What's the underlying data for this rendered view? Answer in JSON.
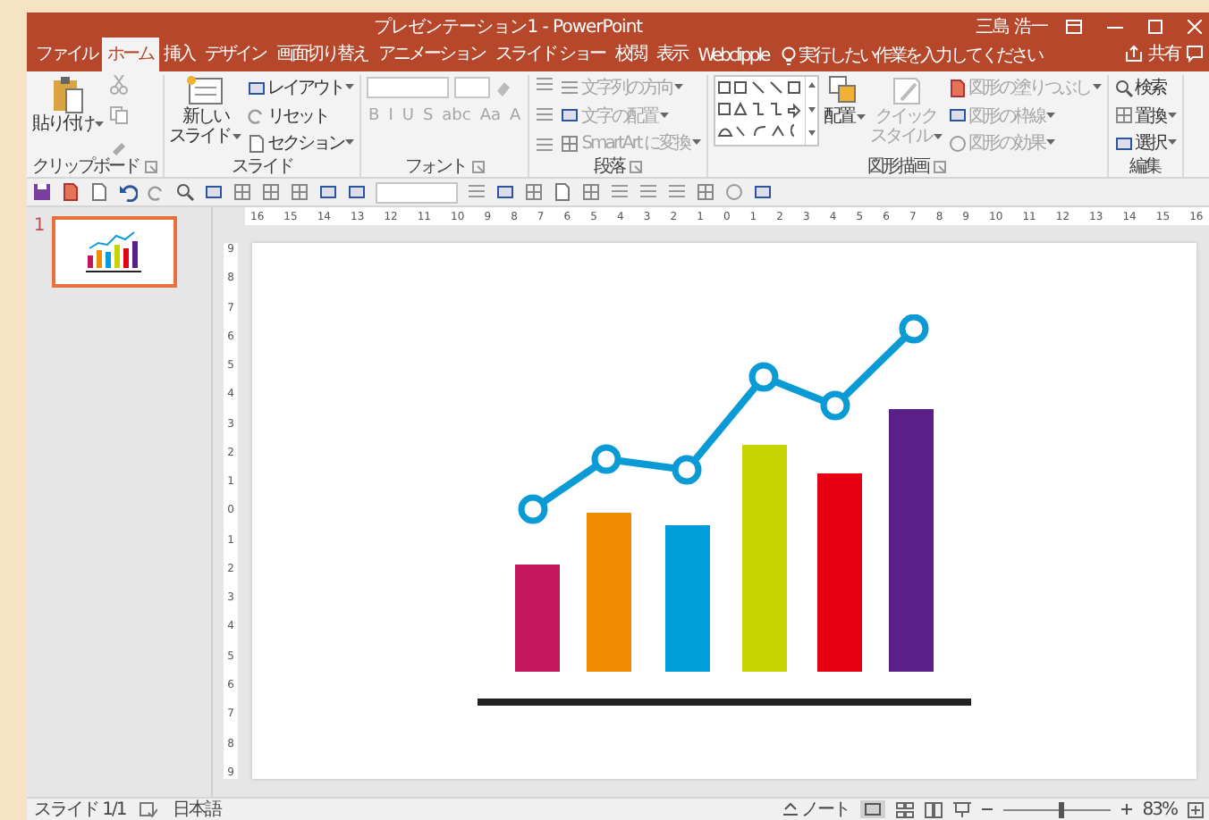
{
  "window": {
    "title": "プレゼンテーション1 - PowerPoint",
    "user": "三島 浩一"
  },
  "tabs": [
    {
      "label": "ファイル",
      "selected": false
    },
    {
      "label": "ホーム",
      "selected": true
    },
    {
      "label": "挿入",
      "selected": false
    },
    {
      "label": "デザイン",
      "selected": false
    },
    {
      "label": "画面切り替え",
      "selected": false
    },
    {
      "label": "アニメーション",
      "selected": false
    },
    {
      "label": "スライド ショー",
      "selected": false
    },
    {
      "label": "校閲",
      "selected": false
    },
    {
      "label": "表示",
      "selected": false
    },
    {
      "label": "Webclipple",
      "selected": false
    }
  ],
  "tell_me": {
    "placeholder": "実行したい作業を入力してください"
  },
  "share": "共有",
  "ribbon": {
    "groups": [
      {
        "kind": "clipboard",
        "label": "クリップボード",
        "disabled": false,
        "paste": "貼り付け"
      },
      {
        "kind": "slides",
        "label": "スライド",
        "disabled": false,
        "new_slide": [
          "新しい",
          "スライド"
        ],
        "commands": [
          "レイアウト",
          "リセット",
          "セクション"
        ]
      },
      {
        "kind": "font",
        "label": "フォント",
        "disabled": true,
        "styles": [
          "B",
          "I",
          "U",
          "S",
          "abc",
          "Aa",
          "A"
        ]
      },
      {
        "kind": "paragraph",
        "label": "段落",
        "disabled": true,
        "commands": [
          "文字列の方向",
          "文字の配置",
          "SmartArt に変換"
        ]
      },
      {
        "kind": "drawing",
        "label": "図形描画",
        "disabled": true,
        "arrange": "配置",
        "quick_styles": [
          "クイック",
          "スタイル"
        ],
        "commands": [
          "図形の塗りつぶし",
          "図形の枠線",
          "図形の効果"
        ]
      },
      {
        "kind": "editing",
        "label": "編集",
        "disabled": false,
        "commands": [
          "検索",
          "置換",
          "選択"
        ]
      }
    ]
  },
  "ruler": {
    "horizontal": [
      "16",
      "15",
      "14",
      "13",
      "12",
      "11",
      "10",
      "9",
      "8",
      "7",
      "6",
      "5",
      "4",
      "3",
      "2",
      "1",
      "0",
      "1",
      "2",
      "3",
      "4",
      "5",
      "6",
      "7",
      "8",
      "9",
      "10",
      "11",
      "12",
      "13",
      "14",
      "15",
      "16"
    ],
    "vertical": [
      "9",
      "8",
      "7",
      "6",
      "5",
      "4",
      "3",
      "2",
      "1",
      "0",
      "1",
      "2",
      "3",
      "4",
      "5",
      "6",
      "7",
      "8",
      "9"
    ]
  },
  "slides": [
    {
      "number": "1",
      "selected": true
    }
  ],
  "status_bar": {
    "slide": "スライド 1/1",
    "language": "日本語",
    "notes": "ノート",
    "zoom": {
      "level": 0.55,
      "reading": "83%"
    }
  }
}
